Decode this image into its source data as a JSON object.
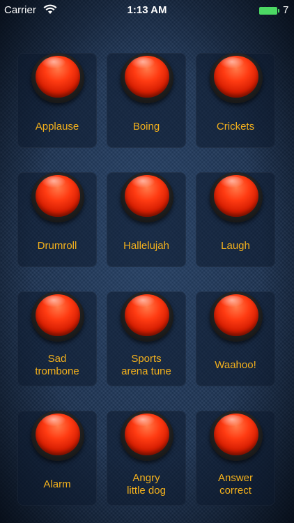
{
  "status_bar": {
    "carrier": "Carrier",
    "time": "1:13 AM",
    "battery_extra": "7"
  },
  "colors": {
    "label": "#f4b11c",
    "buzzer": "#ff3b12",
    "background": "#1d3352",
    "battery": "#4cd964"
  },
  "buttons": [
    {
      "label": "Applause",
      "icon": "red-buzzer-icon"
    },
    {
      "label": "Boing",
      "icon": "red-buzzer-icon"
    },
    {
      "label": "Crickets",
      "icon": "red-buzzer-icon"
    },
    {
      "label": "Drumroll",
      "icon": "red-buzzer-icon"
    },
    {
      "label": "Hallelujah",
      "icon": "red-buzzer-icon"
    },
    {
      "label": "Laugh",
      "icon": "red-buzzer-icon"
    },
    {
      "label": "Sad\ntrombone",
      "icon": "red-buzzer-icon"
    },
    {
      "label": "Sports\narena tune",
      "icon": "red-buzzer-icon"
    },
    {
      "label": "Waahoo!",
      "icon": "red-buzzer-icon"
    },
    {
      "label": "Alarm",
      "icon": "red-buzzer-icon"
    },
    {
      "label": "Angry\nlittle dog",
      "icon": "red-buzzer-icon"
    },
    {
      "label": "Answer\ncorrect",
      "icon": "red-buzzer-icon"
    }
  ]
}
